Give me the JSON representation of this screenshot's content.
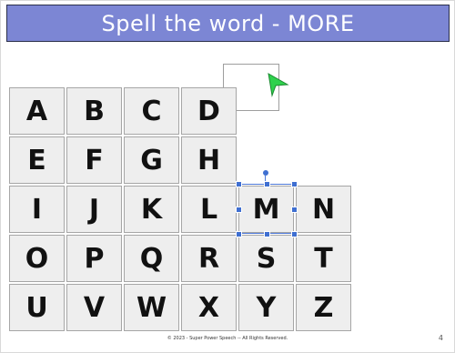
{
  "title": "Spell the word - MORE",
  "tiles": [
    {
      "letter": "A",
      "row": 0,
      "col": 0
    },
    {
      "letter": "B",
      "row": 0,
      "col": 1
    },
    {
      "letter": "C",
      "row": 0,
      "col": 2
    },
    {
      "letter": "D",
      "row": 0,
      "col": 3
    },
    {
      "letter": "E",
      "row": 1,
      "col": 0
    },
    {
      "letter": "F",
      "row": 1,
      "col": 1
    },
    {
      "letter": "G",
      "row": 1,
      "col": 2
    },
    {
      "letter": "H",
      "row": 1,
      "col": 3
    },
    {
      "letter": "I",
      "row": 2,
      "col": 0
    },
    {
      "letter": "J",
      "row": 2,
      "col": 1
    },
    {
      "letter": "K",
      "row": 2,
      "col": 2
    },
    {
      "letter": "L",
      "row": 2,
      "col": 3
    },
    {
      "letter": "M",
      "row": 2,
      "col": 4
    },
    {
      "letter": "N",
      "row": 2,
      "col": 5
    },
    {
      "letter": "O",
      "row": 3,
      "col": 0
    },
    {
      "letter": "P",
      "row": 3,
      "col": 1
    },
    {
      "letter": "Q",
      "row": 3,
      "col": 2
    },
    {
      "letter": "R",
      "row": 3,
      "col": 3
    },
    {
      "letter": "S",
      "row": 3,
      "col": 4
    },
    {
      "letter": "T",
      "row": 3,
      "col": 5
    },
    {
      "letter": "U",
      "row": 4,
      "col": 0
    },
    {
      "letter": "V",
      "row": 4,
      "col": 1
    },
    {
      "letter": "W",
      "row": 4,
      "col": 2
    },
    {
      "letter": "X",
      "row": 4,
      "col": 3
    },
    {
      "letter": "Y",
      "row": 4,
      "col": 4
    },
    {
      "letter": "Z",
      "row": 4,
      "col": 5
    }
  ],
  "selected_letter": "M",
  "arrow_icon": "green-pointer-arrow-icon",
  "footer": "© 2023 - Super Power Speech -- All Rights Reserved.",
  "page_number": "4",
  "colors": {
    "title_bg": "#7c86d4",
    "tile_bg": "#eeeeee",
    "arrow": "#2fd14d",
    "selection": "#3f6fd1"
  }
}
